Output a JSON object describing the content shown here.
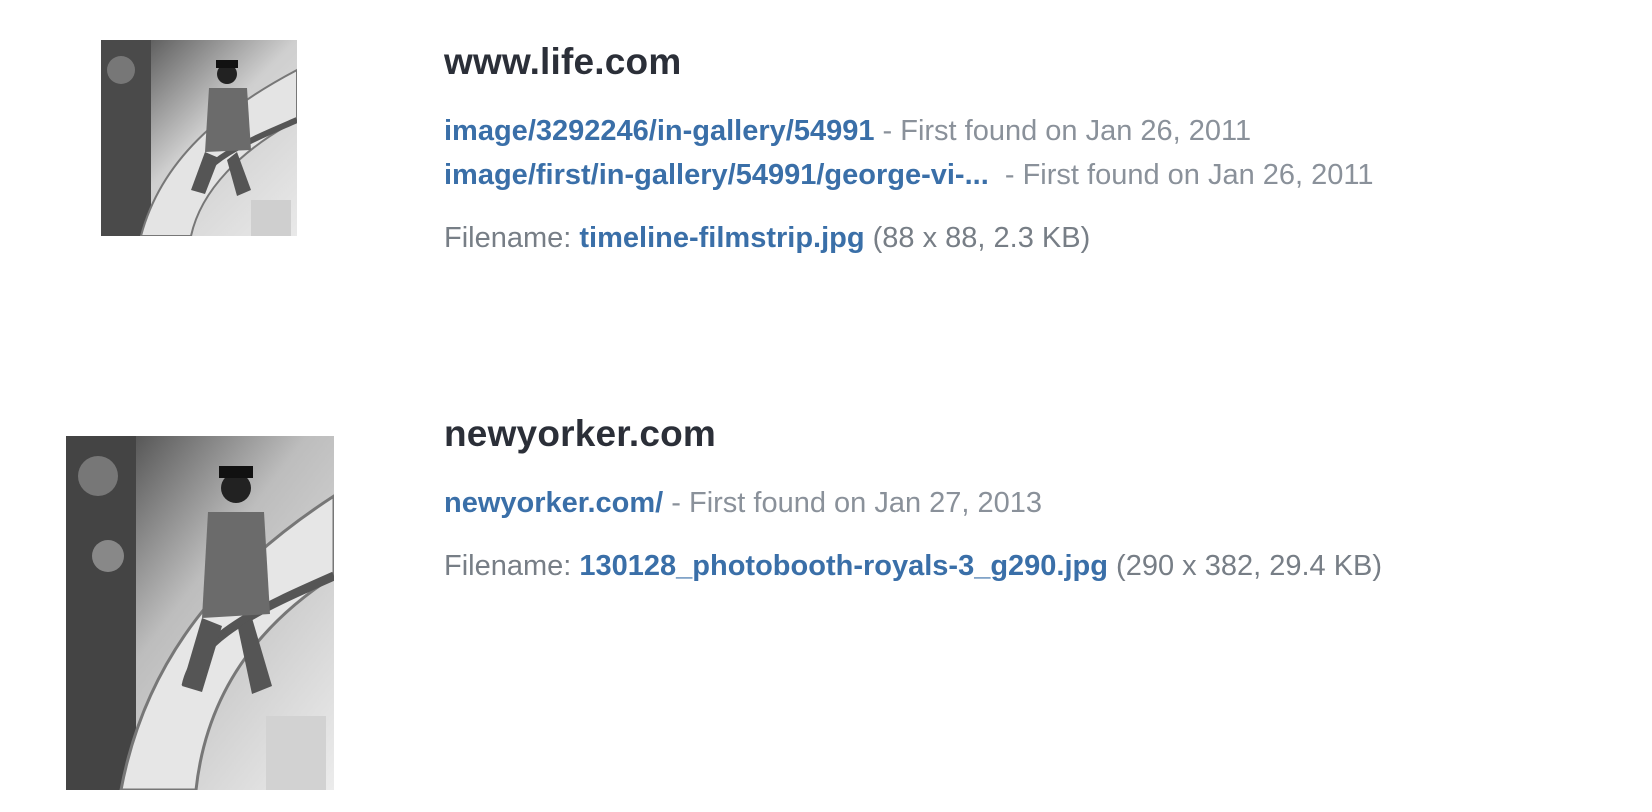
{
  "results": [
    {
      "domain": "www.life.com",
      "occurrences": [
        {
          "link": "image/3292246/in-gallery/54991",
          "first_found": " - First found on Jan 26, 2011"
        },
        {
          "link": "image/first/in-gallery/54991/george-vi-...",
          "first_found": "  - First found on Jan 26, 2011"
        }
      ],
      "filename_label": "Filename: ",
      "filename": "timeline-filmstrip.jpg",
      "file_details": " (88 x 88, 2.3 KB)",
      "thumbnail_icon": "photo-thumbnail"
    },
    {
      "domain": "newyorker.com",
      "occurrences": [
        {
          "link": "newyorker.com/",
          "first_found": " - First found on Jan 27, 2013"
        }
      ],
      "filename_label": "Filename: ",
      "filename": "130128_photobooth-royals-3_g290.jpg",
      "file_details": " (290 x 382, 29.4 KB)",
      "thumbnail_icon": "photo-thumbnail"
    }
  ]
}
